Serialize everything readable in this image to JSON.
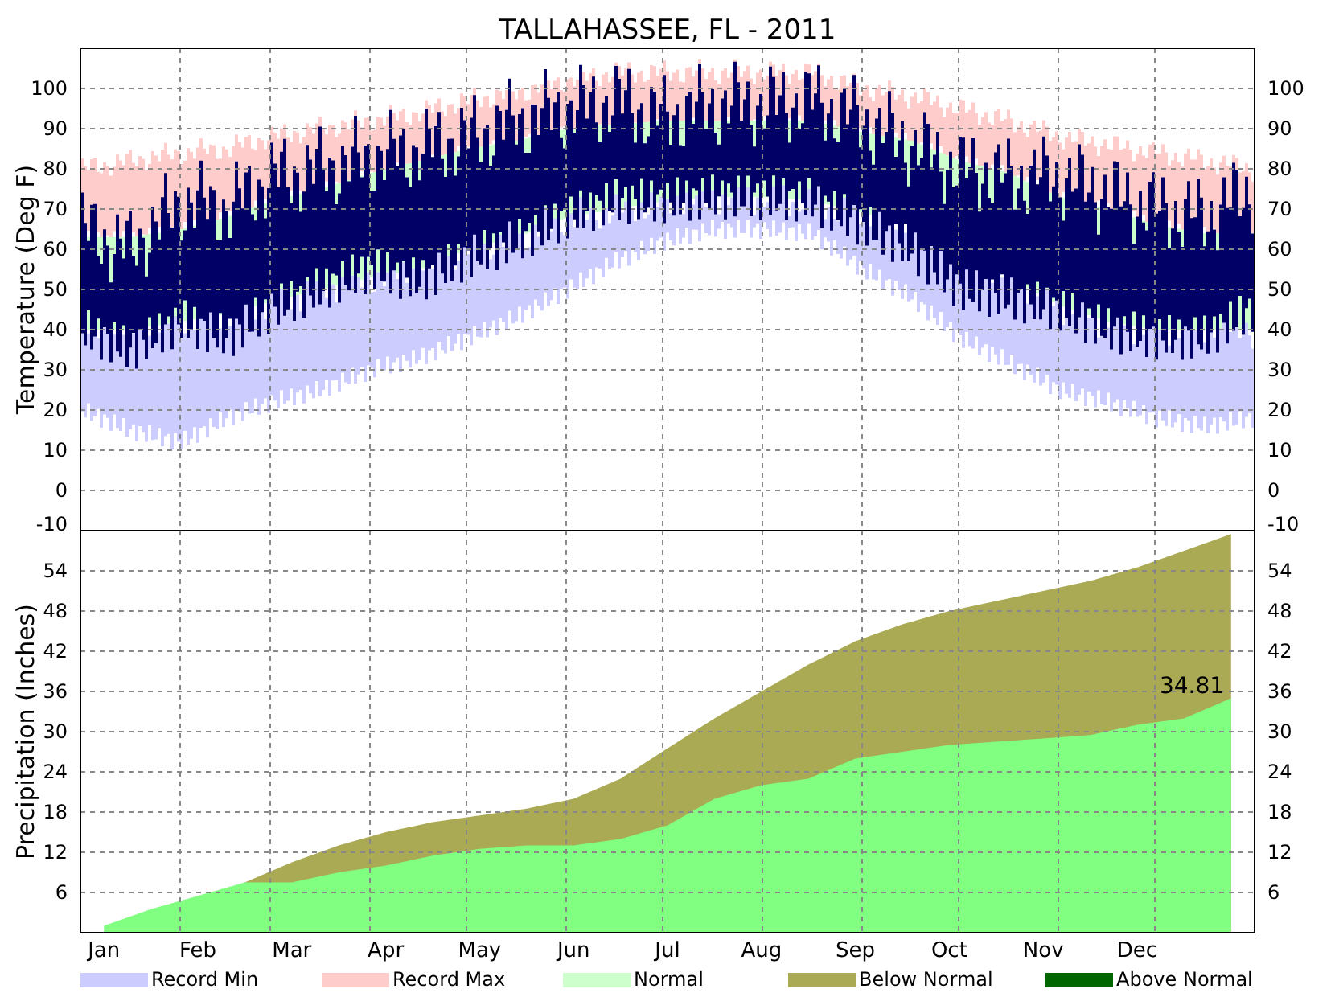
{
  "title": "TALLAHASSEE, FL - 2011",
  "temperature": {
    "ylabel": "Temperature (Deg F)",
    "left_axis_labels": [
      "100",
      "90",
      "80",
      "70",
      "60",
      "50",
      "40",
      "30",
      "20",
      "10",
      "0",
      "-10"
    ],
    "right_axis_labels": [
      "100",
      "90",
      "80",
      "70",
      "60",
      "50",
      "40",
      "30",
      "20",
      "10",
      "0",
      "-10"
    ]
  },
  "precipitation": {
    "chart_data": {
      "type": "area",
      "ylabel": "Precipitation (Inches)",
      "ylim": [
        0,
        60
      ],
      "grid": true,
      "yticks": [
        6,
        12,
        18,
        24,
        30,
        36,
        42,
        48,
        54
      ],
      "categories": [
        "Jan",
        null,
        "Feb",
        null,
        "Mar",
        null,
        "Apr",
        null,
        "May",
        null,
        "Jun",
        null,
        "Jul",
        null,
        "Aug",
        null,
        "Sep",
        null,
        "Oct",
        null,
        "Nov",
        null,
        "Dec",
        null,
        null
      ],
      "series": [
        {
          "color": "#aaaa55",
          "values": [
            null,
            null,
            null,
            7.5,
            10.5,
            13,
            15,
            16.5,
            17.5,
            18.5,
            20,
            23,
            27.5,
            32,
            36,
            40,
            43.5,
            46,
            48,
            49.5,
            51,
            52.5,
            54.5,
            57,
            59.5
          ]
        },
        {
          "color": "#80ff80",
          "values": [
            1,
            3.5,
            5.5,
            7.5,
            7.5,
            9,
            10,
            11.5,
            12.5,
            13,
            13,
            14,
            16,
            20,
            22,
            23,
            26,
            27,
            28,
            28.5,
            29,
            29.5,
            31,
            32,
            35
          ]
        }
      ],
      "annotations": [
        "34.81"
      ]
    },
    "left_axis_labels": [
      "54",
      "48",
      "42",
      "36",
      "30",
      "24",
      "18",
      "12",
      "6"
    ],
    "right_axis_labels": [
      "54",
      "48",
      "42",
      "36",
      "30",
      "24",
      "18",
      "12",
      "6"
    ]
  },
  "legend": [
    {
      "label": "Record Min",
      "color": "#ccccff"
    },
    {
      "label": "Record Max",
      "color": "#ffcccc"
    },
    {
      "label": "Normal",
      "color": "#ccffcc"
    },
    {
      "label": "Below Normal",
      "color": "#aaaa55"
    },
    {
      "label": "Above Normal",
      "color": "#006600"
    }
  ]
}
